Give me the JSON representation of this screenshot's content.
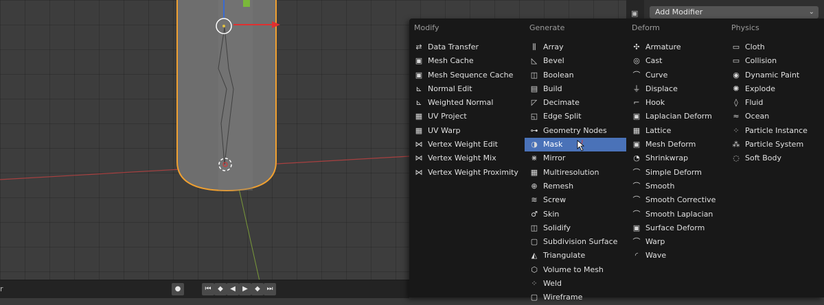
{
  "header": {
    "add_modifier_label": "Add Modifier"
  },
  "menu": {
    "columns": [
      {
        "title": "Modify",
        "items": [
          {
            "label": "Data Transfer",
            "icon": "data-transfer-icon",
            "glyph": "⇄"
          },
          {
            "label": "Mesh Cache",
            "icon": "mesh-cache-icon",
            "glyph": "▣"
          },
          {
            "label": "Mesh Sequence Cache",
            "icon": "mesh-sequence-cache-icon",
            "glyph": "▣"
          },
          {
            "label": "Normal Edit",
            "icon": "normal-edit-icon",
            "glyph": "⊾"
          },
          {
            "label": "Weighted Normal",
            "icon": "weighted-normal-icon",
            "glyph": "⊾"
          },
          {
            "label": "UV Project",
            "icon": "uv-project-icon",
            "glyph": "▦"
          },
          {
            "label": "UV Warp",
            "icon": "uv-warp-icon",
            "glyph": "▦"
          },
          {
            "label": "Vertex Weight Edit",
            "icon": "vertex-weight-edit-icon",
            "glyph": "⋈"
          },
          {
            "label": "Vertex Weight Mix",
            "icon": "vertex-weight-mix-icon",
            "glyph": "⋈"
          },
          {
            "label": "Vertex Weight Proximity",
            "icon": "vertex-weight-proximity-icon",
            "glyph": "⋈"
          }
        ]
      },
      {
        "title": "Generate",
        "items": [
          {
            "label": "Array",
            "icon": "array-icon",
            "glyph": "⫼"
          },
          {
            "label": "Bevel",
            "icon": "bevel-icon",
            "glyph": "◺"
          },
          {
            "label": "Boolean",
            "icon": "boolean-icon",
            "glyph": "◫"
          },
          {
            "label": "Build",
            "icon": "build-icon",
            "glyph": "▤"
          },
          {
            "label": "Decimate",
            "icon": "decimate-icon",
            "glyph": "◸"
          },
          {
            "label": "Edge Split",
            "icon": "edge-split-icon",
            "glyph": "◱"
          },
          {
            "label": "Geometry Nodes",
            "icon": "geometry-nodes-icon",
            "glyph": "⊶"
          },
          {
            "label": "Mask",
            "icon": "mask-icon",
            "glyph": "◑"
          },
          {
            "label": "Mirror",
            "icon": "mirror-icon",
            "glyph": "⋇"
          },
          {
            "label": "Multiresolution",
            "icon": "multiresolution-icon",
            "glyph": "▦"
          },
          {
            "label": "Remesh",
            "icon": "remesh-icon",
            "glyph": "⊕"
          },
          {
            "label": "Screw",
            "icon": "screw-icon",
            "glyph": "≋"
          },
          {
            "label": "Skin",
            "icon": "skin-icon",
            "glyph": "♂"
          },
          {
            "label": "Solidify",
            "icon": "solidify-icon",
            "glyph": "◫"
          },
          {
            "label": "Subdivision Surface",
            "icon": "subdivision-surface-icon",
            "glyph": "▢"
          },
          {
            "label": "Triangulate",
            "icon": "triangulate-icon",
            "glyph": "◭"
          },
          {
            "label": "Volume to Mesh",
            "icon": "volume-to-mesh-icon",
            "glyph": "⬡"
          },
          {
            "label": "Weld",
            "icon": "weld-icon",
            "glyph": "⁘"
          },
          {
            "label": "Wireframe",
            "icon": "wireframe-icon",
            "glyph": "▢"
          }
        ]
      },
      {
        "title": "Deform",
        "items": [
          {
            "label": "Armature",
            "icon": "armature-icon",
            "glyph": "✣"
          },
          {
            "label": "Cast",
            "icon": "cast-icon",
            "glyph": "◎"
          },
          {
            "label": "Curve",
            "icon": "curve-icon",
            "glyph": "⌒"
          },
          {
            "label": "Displace",
            "icon": "displace-icon",
            "glyph": "⏚"
          },
          {
            "label": "Hook",
            "icon": "hook-icon",
            "glyph": "⌐"
          },
          {
            "label": "Laplacian Deform",
            "icon": "laplacian-deform-icon",
            "glyph": "▣"
          },
          {
            "label": "Lattice",
            "icon": "lattice-icon",
            "glyph": "▦"
          },
          {
            "label": "Mesh Deform",
            "icon": "mesh-deform-icon",
            "glyph": "▣"
          },
          {
            "label": "Shrinkwrap",
            "icon": "shrinkwrap-icon",
            "glyph": "◔"
          },
          {
            "label": "Simple Deform",
            "icon": "simple-deform-icon",
            "glyph": "⌒"
          },
          {
            "label": "Smooth",
            "icon": "smooth-icon",
            "glyph": "⌒"
          },
          {
            "label": "Smooth Corrective",
            "icon": "smooth-corrective-icon",
            "glyph": "⌒"
          },
          {
            "label": "Smooth Laplacian",
            "icon": "smooth-laplacian-icon",
            "glyph": "⌒"
          },
          {
            "label": "Surface Deform",
            "icon": "surface-deform-icon",
            "glyph": "▣"
          },
          {
            "label": "Warp",
            "icon": "warp-icon",
            "glyph": "⌒"
          },
          {
            "label": "Wave",
            "icon": "wave-icon",
            "glyph": "◜"
          }
        ]
      },
      {
        "title": "Physics",
        "items": [
          {
            "label": "Cloth",
            "icon": "cloth-icon",
            "glyph": "▭"
          },
          {
            "label": "Collision",
            "icon": "collision-icon",
            "glyph": "▭"
          },
          {
            "label": "Dynamic Paint",
            "icon": "dynamic-paint-icon",
            "glyph": "◉"
          },
          {
            "label": "Explode",
            "icon": "explode-icon",
            "glyph": "✺"
          },
          {
            "label": "Fluid",
            "icon": "fluid-icon",
            "glyph": "◊"
          },
          {
            "label": "Ocean",
            "icon": "ocean-icon",
            "glyph": "≈"
          },
          {
            "label": "Particle Instance",
            "icon": "particle-instance-icon",
            "glyph": "⁘"
          },
          {
            "label": "Particle System",
            "icon": "particle-system-icon",
            "glyph": "⁂"
          },
          {
            "label": "Soft Body",
            "icon": "soft-body-icon",
            "glyph": "◌"
          }
        ]
      }
    ],
    "active_item": "Mask"
  },
  "timeline": {
    "left_fragment": "r",
    "buttons": [
      {
        "name": "record-button",
        "glyph": "●"
      },
      {
        "name": "jump-start-button",
        "glyph": "⏮"
      },
      {
        "name": "prev-keyframe-button",
        "glyph": "◆"
      },
      {
        "name": "play-reverse-button",
        "glyph": "◀"
      },
      {
        "name": "play-button",
        "glyph": "▶"
      },
      {
        "name": "next-keyframe-button",
        "glyph": "◆"
      },
      {
        "name": "jump-end-button",
        "glyph": "⏭"
      }
    ]
  },
  "colors": {
    "highlight": "#4a72b8",
    "menu_bg": "#181818",
    "selection_outline": "#f0a030",
    "x_axis": "#c04040"
  }
}
